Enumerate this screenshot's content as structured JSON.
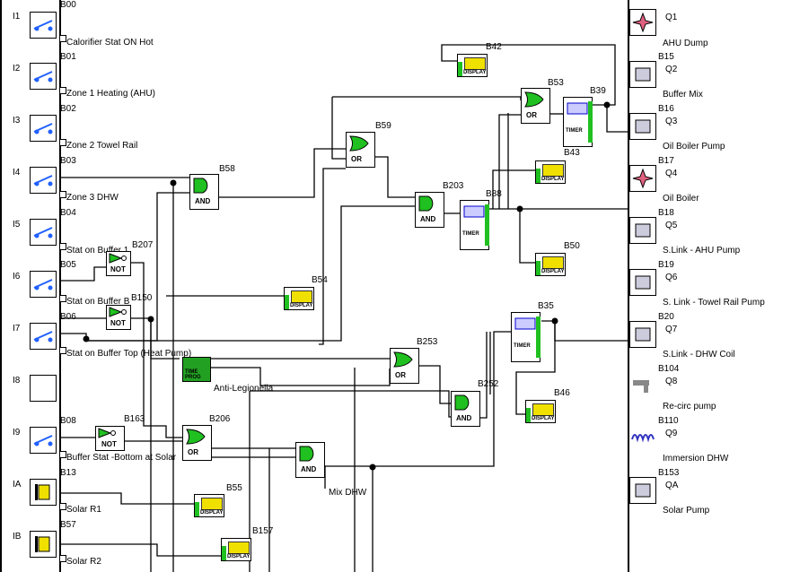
{
  "inputs": [
    {
      "pin": "I1",
      "block": "B00",
      "label": "Calorifier Stat ON Hot"
    },
    {
      "pin": "I2",
      "block": "B01",
      "label": "Zone 1 Heating (AHU)"
    },
    {
      "pin": "I3",
      "block": "B02",
      "label": "Zone 2 Towel Rail"
    },
    {
      "pin": "I4",
      "block": "B03",
      "label": "Zone 3 DHW"
    },
    {
      "pin": "I5",
      "block": "B04",
      "label": "Stat on Buffer 1"
    },
    {
      "pin": "I6",
      "block": "B05",
      "label": "Stat on Buffer B"
    },
    {
      "pin": "I7",
      "block": "B06",
      "label": "Stat on Buffer Top (Heat Pump)"
    },
    {
      "pin": "I8",
      "block": "",
      "label": ""
    },
    {
      "pin": "I9",
      "block": "B08",
      "label": "Buffer Stat -Bottom at Solar"
    },
    {
      "pin": "IA",
      "block": "B13",
      "label": "Solar R1"
    },
    {
      "pin": "IB",
      "block": "B57",
      "label": "Solar R2"
    }
  ],
  "outputs": [
    {
      "pin": "Q1",
      "block": "",
      "label": "AHU Dump"
    },
    {
      "pin": "Q2",
      "block": "B15",
      "label": "Buffer Mix"
    },
    {
      "pin": "Q3",
      "block": "B16",
      "label": "Oil Boiler Pump"
    },
    {
      "pin": "Q4",
      "block": "B17",
      "label": "Oil Boiler"
    },
    {
      "pin": "Q5",
      "block": "B18",
      "label": "S.Link - AHU Pump"
    },
    {
      "pin": "Q6",
      "block": "B19",
      "label": "S. Link - Towel Rail Pump"
    },
    {
      "pin": "Q7",
      "block": "B20",
      "label": "S.Link - DHW Coil"
    },
    {
      "pin": "Q8",
      "block": "B104",
      "label": "Re-circ pump"
    },
    {
      "pin": "Q9",
      "block": "B110",
      "label": "Immersion DHW"
    },
    {
      "pin": "QA",
      "block": "B153",
      "label": "Solar Pump"
    }
  ],
  "gates": {
    "b58": {
      "id": "B58",
      "type": "AND"
    },
    "b59": {
      "id": "B59",
      "type": "OR"
    },
    "b203": {
      "id": "B203",
      "type": "AND"
    },
    "b53": {
      "id": "B53",
      "type": "OR"
    },
    "b253": {
      "id": "B253",
      "type": "OR"
    },
    "b252": {
      "id": "B252",
      "type": "AND"
    },
    "b206": {
      "id": "B206",
      "type": "OR"
    },
    "b207": {
      "id": "B207",
      "type": "NOT"
    },
    "b150": {
      "id": "B150",
      "type": "NOT"
    },
    "b163": {
      "id": "B163",
      "type": "NOT"
    },
    "mixand": {
      "id": "",
      "type": "AND",
      "label": "Mix DHW"
    }
  },
  "displays": [
    "B42",
    "B43",
    "B50",
    "B54",
    "B46",
    "B55",
    "B157"
  ],
  "display_text": "DISPLAY",
  "timers": [
    "B39",
    "B88",
    "B35"
  ],
  "timer_text": "TIMER",
  "timeprog": {
    "id": "",
    "label": "Anti-Legionella",
    "text": "TIME PROG"
  }
}
